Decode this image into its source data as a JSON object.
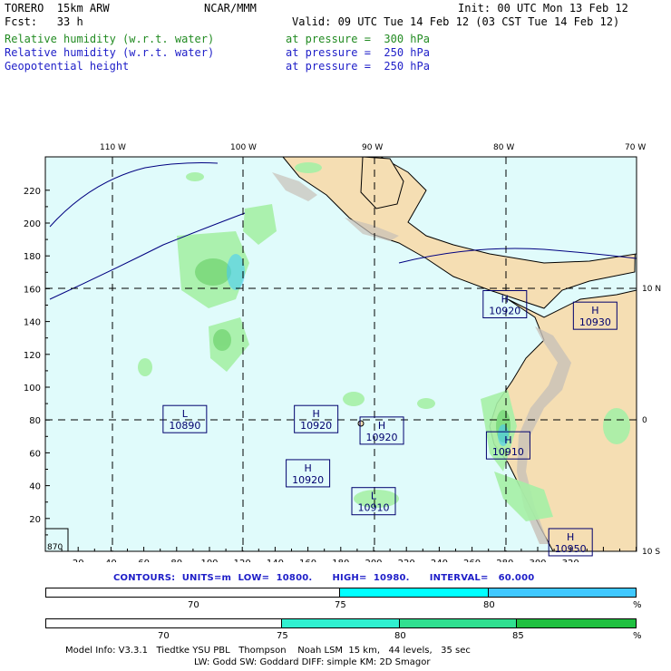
{
  "header": {
    "model": "TORERO  15km ARW",
    "center": "NCAR/MMM",
    "init": "Init: 00 UTC Mon 13 Feb 12",
    "fcst": "Fcst:   33 h",
    "valid": "Valid: 09 UTC Tue 14 Feb 12 (03 CST Tue 14 Feb 12)",
    "fields": [
      {
        "name": "Relative humidity (w.r.t. water)",
        "level": "at pressure =  300 hPa",
        "color": "#228b22"
      },
      {
        "name": "Relative humidity (w.r.t. water)",
        "level": "at pressure =  250 hPa",
        "color": "#1e1ec8"
      },
      {
        "name": "Geopotential height",
        "level": "at pressure =  250 hPa",
        "color": "#1e1ec8"
      }
    ]
  },
  "map": {
    "top_lon_labels": [
      "110 W",
      "100 W",
      "90 W",
      "80 W",
      "70 W"
    ],
    "right_lat_labels": [
      "10 N",
      "0",
      "10 S"
    ],
    "y_grid_labels": [
      "220",
      "200",
      "180",
      "160",
      "140",
      "120",
      "100",
      "80",
      "60",
      "40",
      "20"
    ],
    "x_grid_labels": [
      "20",
      "40",
      "60",
      "80",
      "100",
      "120",
      "140",
      "160",
      "180",
      "200",
      "220",
      "240",
      "260",
      "280",
      "300",
      "320"
    ],
    "pressure_centers": [
      {
        "type": "L",
        "value": "10890"
      },
      {
        "type": "H",
        "value": "10920"
      },
      {
        "type": "H",
        "value": "10920"
      },
      {
        "type": "H",
        "value": "10920"
      },
      {
        "type": "L",
        "value": "10910"
      },
      {
        "type": "H",
        "value": "10920"
      },
      {
        "type": "H",
        "value": "10930"
      },
      {
        "type": "H",
        "value": "10910"
      },
      {
        "type": "H",
        "value": "10950"
      }
    ],
    "corner_label": "870",
    "colors": {
      "ocean": "#e0fbfb",
      "land": "#f5deb3",
      "rh_light": "#a6f0a6",
      "rh_mid": "#7cd97c",
      "coast": "#000080"
    }
  },
  "contours": "CONTOURS:  UNITS=m  LOW=  10800.      HIGH=  10980.      INTERVAL=   60.000",
  "legend_blue": {
    "ticks": [
      "70",
      "75",
      "80",
      "%"
    ],
    "colors": [
      "#ffffff",
      "#00ffff",
      "#40c8ff"
    ]
  },
  "legend_green": {
    "ticks": [
      "70",
      "75",
      "80",
      "85",
      "%"
    ],
    "colors": [
      "#ffffff",
      "#30f0d0",
      "#30e090",
      "#20c040"
    ]
  },
  "footer": {
    "line1": "Model Info: V3.3.1   Tiedtke YSU PBL   Thompson    Noah LSM  15 km,   44 levels,   35 sec",
    "line2": "LW: Godd SW: Goddard DIFF: simple KM: 2D Smagor"
  }
}
